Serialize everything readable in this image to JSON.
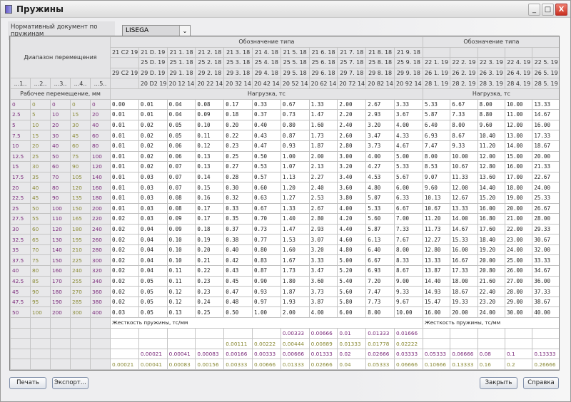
{
  "window": {
    "title": "Пружины",
    "minimize": "_",
    "maximize": "□",
    "close": "X"
  },
  "doc": {
    "label": "Нормативный документ по пружинам",
    "value": "LISEGA"
  },
  "header": {
    "range_label": "Диапазон перемещения",
    "designation_label": "Обозначение типа",
    "range_cols": [
      "...1..",
      "...2..",
      "...3..",
      "...4..",
      "...5.."
    ],
    "work_label": "Рабочее перемещение, мм",
    "load_label": "Нагрузка, тс",
    "codes_main": [
      [
        "21 C2 19",
        "21 D. 19",
        "21 1. 18",
        "21 2. 18",
        "21 3. 18",
        "21 4. 18",
        "21 5. 18",
        "21 6. 18",
        "21 7. 18",
        "21 8. 18",
        "21 9. 18"
      ],
      [
        "",
        "25 D. 19",
        "25 1. 18",
        "25 2. 18",
        "25 3. 18",
        "25 4. 18",
        "25 5. 18",
        "25 6. 18",
        "25 7. 18",
        "25 8. 18",
        "25 9. 18"
      ],
      [
        "29 C2 19",
        "29 D. 19",
        "29 1. 18",
        "29 2. 18",
        "29 3. 18",
        "29 4. 18",
        "29 5. 18",
        "29 6. 18",
        "29 7. 18",
        "29 8. 18",
        "29 9. 18"
      ],
      [
        "",
        "20 D2 19",
        "20 12 14",
        "20 22 14",
        "20 32 14",
        "20 42 14",
        "20 52 14",
        "20 62 14",
        "20 72 14",
        "20 82 14",
        "20 92 14"
      ]
    ],
    "codes_right": [
      [
        "",
        "",
        "",
        "",
        ""
      ],
      [
        "22 1. 19",
        "22 2. 19",
        "22 3. 19",
        "22 4. 19",
        "22 5. 19"
      ],
      [
        "26 1. 19",
        "26 2. 19",
        "26 3. 19",
        "26 4. 19",
        "26 5. 19"
      ],
      [
        "28 1. 19",
        "28 2. 19",
        "28 3. 19",
        "28 4. 19",
        "28 5. 19"
      ]
    ]
  },
  "displacements": [
    [
      0,
      0,
      0,
      0,
      0
    ],
    [
      2.5,
      5,
      10,
      15,
      20
    ],
    [
      5,
      10,
      20,
      30,
      40
    ],
    [
      7.5,
      15,
      30,
      45,
      60
    ],
    [
      10,
      20,
      40,
      60,
      80
    ],
    [
      12.5,
      25,
      50,
      75,
      100
    ],
    [
      15,
      30,
      60,
      90,
      120
    ],
    [
      17.5,
      35,
      70,
      105,
      140
    ],
    [
      20,
      40,
      80,
      120,
      160
    ],
    [
      22.5,
      45,
      90,
      135,
      180
    ],
    [
      25,
      50,
      100,
      150,
      200
    ],
    [
      27.5,
      55,
      110,
      165,
      220
    ],
    [
      30,
      60,
      120,
      180,
      240
    ],
    [
      32.5,
      65,
      130,
      195,
      260
    ],
    [
      35,
      70,
      140,
      210,
      280
    ],
    [
      37.5,
      75,
      150,
      225,
      300
    ],
    [
      40,
      80,
      160,
      240,
      320
    ],
    [
      42.5,
      85,
      170,
      255,
      340
    ],
    [
      45,
      90,
      180,
      270,
      360
    ],
    [
      47.5,
      95,
      190,
      285,
      380
    ],
    [
      50,
      100,
      200,
      300,
      400
    ]
  ],
  "load_columns": [
    [
      "0.00",
      "0.01",
      "0.01",
      "0.01",
      "0.01",
      "0.01",
      "0.01",
      "0.01",
      "0.01",
      "0.01",
      "0.01",
      "0.02",
      "0.02",
      "0.02",
      "0.02",
      "0.02",
      "0.02",
      "0.02",
      "0.02",
      "0.02",
      "0.03"
    ],
    [
      "0.01",
      "0.01",
      "0.02",
      "0.02",
      "0.02",
      "0.02",
      "0.02",
      "0.03",
      "0.03",
      "0.03",
      "0.03",
      "0.03",
      "0.04",
      "0.04",
      "0.04",
      "0.04",
      "0.04",
      "0.05",
      "0.05",
      "0.05",
      "0.05"
    ],
    [
      "0.04",
      "0.04",
      "0.05",
      "0.05",
      "0.06",
      "0.06",
      "0.07",
      "0.07",
      "0.07",
      "0.08",
      "0.08",
      "0.09",
      "0.09",
      "0.10",
      "0.10",
      "0.10",
      "0.11",
      "0.11",
      "0.12",
      "0.12",
      "0.13"
    ],
    [
      "0.08",
      "0.09",
      "0.10",
      "0.11",
      "0.12",
      "0.13",
      "0.13",
      "0.14",
      "0.15",
      "0.16",
      "0.17",
      "0.17",
      "0.18",
      "0.19",
      "0.20",
      "0.21",
      "0.22",
      "0.23",
      "0.23",
      "0.24",
      "0.25"
    ],
    [
      "0.17",
      "0.18",
      "0.20",
      "0.22",
      "0.23",
      "0.25",
      "0.27",
      "0.28",
      "0.30",
      "0.32",
      "0.33",
      "0.35",
      "0.37",
      "0.38",
      "0.40",
      "0.42",
      "0.43",
      "0.45",
      "0.47",
      "0.48",
      "0.50"
    ],
    [
      "0.33",
      "0.37",
      "0.40",
      "0.43",
      "0.47",
      "0.50",
      "0.53",
      "0.57",
      "0.60",
      "0.63",
      "0.67",
      "0.70",
      "0.73",
      "0.77",
      "0.80",
      "0.83",
      "0.87",
      "0.90",
      "0.93",
      "0.97",
      "1.00"
    ],
    [
      "0.67",
      "0.73",
      "0.80",
      "0.87",
      "0.93",
      "1.00",
      "1.07",
      "1.13",
      "1.20",
      "1.27",
      "1.33",
      "1.40",
      "1.47",
      "1.53",
      "1.60",
      "1.67",
      "1.73",
      "1.80",
      "1.87",
      "1.93",
      "2.00"
    ],
    [
      "1.33",
      "1.47",
      "1.60",
      "1.73",
      "1.87",
      "2.00",
      "2.13",
      "2.27",
      "2.40",
      "2.53",
      "2.67",
      "2.80",
      "2.93",
      "3.07",
      "3.20",
      "3.33",
      "3.47",
      "3.60",
      "3.73",
      "3.87",
      "4.00"
    ],
    [
      "2.00",
      "2.20",
      "2.40",
      "2.60",
      "2.80",
      "3.00",
      "3.20",
      "3.40",
      "3.60",
      "3.80",
      "4.00",
      "4.20",
      "4.40",
      "4.60",
      "4.80",
      "5.00",
      "5.20",
      "5.40",
      "5.60",
      "5.80",
      "6.00"
    ],
    [
      "2.67",
      "2.93",
      "3.20",
      "3.47",
      "3.73",
      "4.00",
      "4.27",
      "4.53",
      "4.80",
      "5.07",
      "5.33",
      "5.60",
      "5.87",
      "6.13",
      "6.40",
      "6.67",
      "6.93",
      "7.20",
      "7.47",
      "7.73",
      "8.00"
    ],
    [
      "3.33",
      "3.67",
      "4.00",
      "4.33",
      "4.67",
      "5.00",
      "5.33",
      "5.67",
      "6.00",
      "6.33",
      "6.67",
      "7.00",
      "7.33",
      "7.67",
      "8.00",
      "8.33",
      "8.67",
      "9.00",
      "9.33",
      "9.67",
      "10.00"
    ],
    [
      "5.33",
      "5.87",
      "6.40",
      "6.93",
      "7.47",
      "8.00",
      "8.53",
      "9.07",
      "9.60",
      "10.13",
      "10.67",
      "11.20",
      "11.73",
      "12.27",
      "12.80",
      "13.33",
      "13.87",
      "14.40",
      "14.93",
      "15.47",
      "16.00"
    ],
    [
      "6.67",
      "7.33",
      "8.00",
      "8.67",
      "9.33",
      "10.00",
      "10.67",
      "11.33",
      "12.00",
      "12.67",
      "13.33",
      "14.00",
      "14.67",
      "15.33",
      "16.00",
      "16.67",
      "17.33",
      "18.00",
      "18.67",
      "19.33",
      "20.00"
    ],
    [
      "8.00",
      "8.80",
      "9.60",
      "10.40",
      "11.20",
      "12.00",
      "12.80",
      "13.60",
      "14.40",
      "15.20",
      "16.00",
      "16.80",
      "17.60",
      "18.40",
      "19.20",
      "20.00",
      "20.80",
      "21.60",
      "22.40",
      "23.20",
      "24.00"
    ],
    [
      "10.00",
      "11.00",
      "12.00",
      "13.00",
      "14.00",
      "15.00",
      "16.00",
      "17.00",
      "18.00",
      "19.00",
      "20.00",
      "21.00",
      "22.00",
      "23.00",
      "24.00",
      "25.00",
      "26.00",
      "27.00",
      "28.00",
      "29.00",
      "30.00"
    ],
    [
      "13.33",
      "14.67",
      "16.00",
      "17.33",
      "18.67",
      "20.00",
      "21.33",
      "22.67",
      "24.00",
      "25.33",
      "26.67",
      "28.00",
      "29.33",
      "30.67",
      "32.00",
      "33.33",
      "34.67",
      "36.00",
      "37.33",
      "38.67",
      "40.00"
    ]
  ],
  "stiffness": {
    "label": "Жесткость пружины, тс/мм",
    "rows": [
      [
        "",
        "",
        "",
        "",
        "",
        "",
        "0.00333",
        "0.00666",
        "0.01",
        "0.01333",
        "0.01666",
        "",
        "",
        "",
        "",
        ""
      ],
      [
        "",
        "",
        "",
        "",
        "0.00111",
        "0.00222",
        "0.00444",
        "0.00889",
        "0.01333",
        "0.01778",
        "0.02222",
        "",
        "",
        "",
        "",
        ""
      ],
      [
        "",
        "0.00021",
        "0.00041",
        "0.00083",
        "0.00166",
        "0.00333",
        "0.00666",
        "0.01333",
        "0.02",
        "0.02666",
        "0.03333",
        "0.05333",
        "0.06666",
        "0.08",
        "0.1",
        "0.13333"
      ],
      [
        "0.00021",
        "0.00041",
        "0.00083",
        "0.00156",
        "0.00333",
        "0.00666",
        "0.01333",
        "0.02666",
        "0.04",
        "0.05333",
        "0.06666",
        "0.10666",
        "0.13333",
        "0.16",
        "0.2",
        "0.26666"
      ],
      [
        "",
        "0.00083",
        "0.00166",
        "0.00333",
        "0.00666",
        "0.01333",
        "0.02666",
        "0.05333",
        "0.08",
        "0.10666",
        "0.13333",
        "0.21333",
        "0.26666",
        "0.32",
        "0.4",
        "0.53333"
      ]
    ]
  },
  "colors": {
    "purple": "#7a2a7a",
    "olive": "#8a8a36",
    "header_bg": "#e4e4e6"
  },
  "buttons": {
    "print": "Печать",
    "export": "Экспорт...",
    "close": "Закрыть",
    "help": "Справка"
  }
}
